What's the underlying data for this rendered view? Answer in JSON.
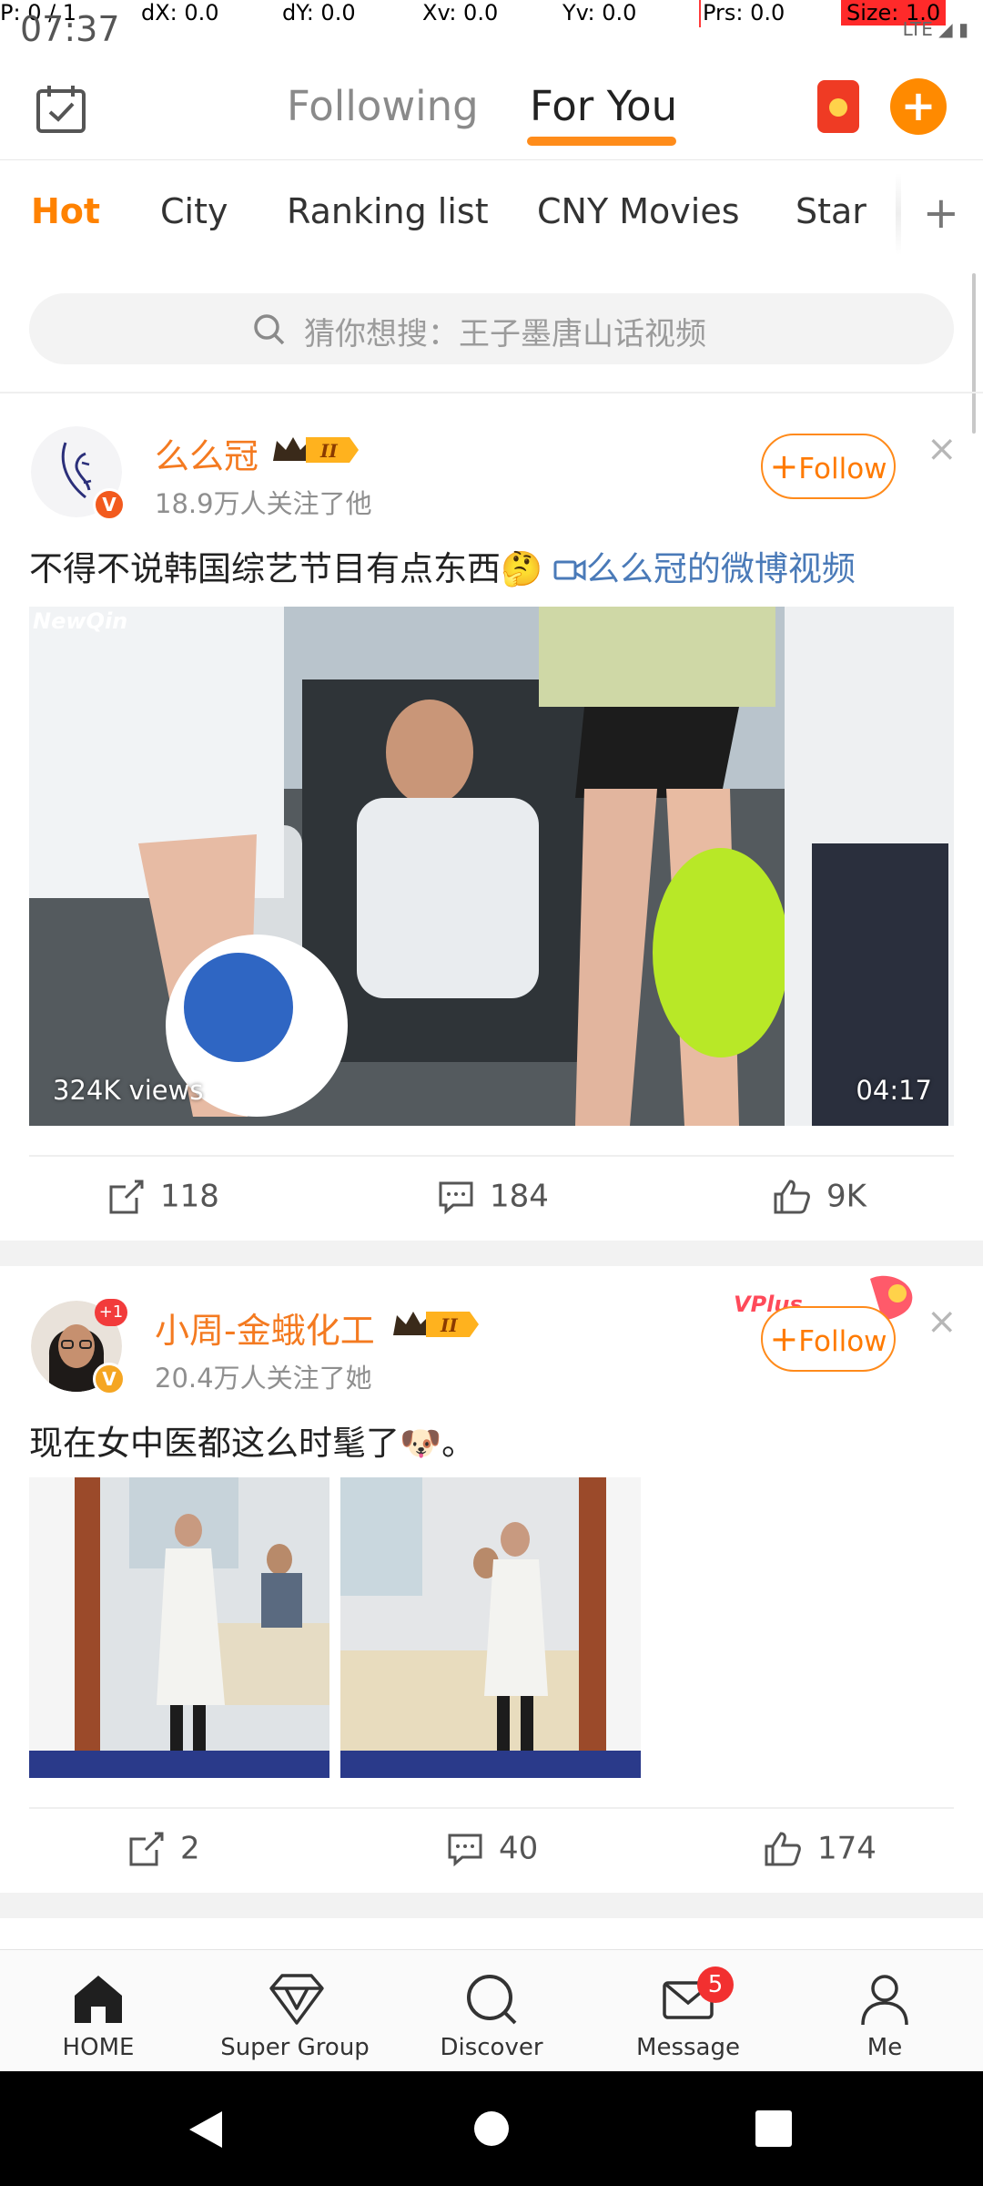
{
  "debug": {
    "p": "P: 0 / 1",
    "dx": "dX: 0.0",
    "dy": "dY: 0.0",
    "xv": "Xv: 0.0",
    "yv": "Yv: 0.0",
    "prs": "Prs: 0.0",
    "size": "Size: 1.0"
  },
  "status": {
    "time": "07:37",
    "network": "LTE"
  },
  "header": {
    "tabs": [
      {
        "label": "Following"
      },
      {
        "label": "For You"
      }
    ],
    "accent_color": "#ff8c1a"
  },
  "channels": {
    "items": [
      "Hot",
      "City",
      "Ranking list",
      "CNY Movies",
      "Star"
    ],
    "active": "Hot"
  },
  "search": {
    "placeholder": "猜你想搜：王子墨唐山话视频"
  },
  "posts": [
    {
      "username": "么么冠",
      "rank_badge": "II",
      "followers": "18.9万人关注了他",
      "follow_label": "Follow",
      "verified": "V",
      "text": "不得不说韩国综艺节目有点东西🤔",
      "link_text": "么么冠的微博视频",
      "video": {
        "views": "324K views",
        "duration": "04:17",
        "watermark": "NewQin"
      },
      "actions": {
        "shares": "118",
        "comments": "184",
        "likes": "9K"
      }
    },
    {
      "username": "小周-金蛾化工",
      "rank_badge": "II",
      "followers": "20.4万人关注了她",
      "follow_label": "Follow",
      "verified": "V",
      "avatar_badge": "+1",
      "promo": "VPlus",
      "text": "现在女中医都这么时髦了🐶。",
      "actions": {
        "shares": "2",
        "comments": "40",
        "likes": "174"
      }
    }
  ],
  "bottom_nav": [
    {
      "label": "HOME",
      "icon": "home-icon"
    },
    {
      "label": "Super Group",
      "icon": "diamond-icon"
    },
    {
      "label": "Discover",
      "icon": "search-icon"
    },
    {
      "label": "Message",
      "icon": "mail-icon",
      "badge": "5"
    },
    {
      "label": "Me",
      "icon": "person-icon"
    }
  ]
}
